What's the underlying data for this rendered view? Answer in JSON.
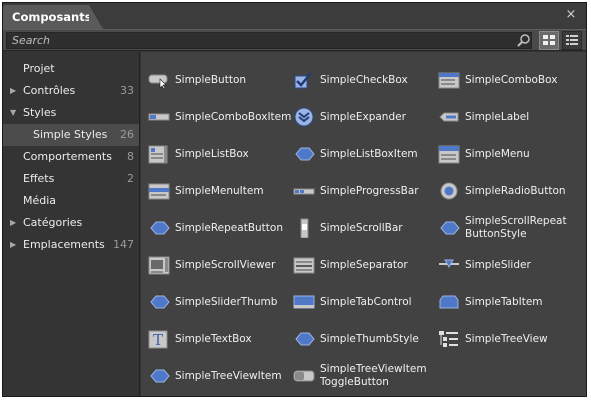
{
  "panel": {
    "tab_label": "Composants",
    "close_glyph": "×"
  },
  "search": {
    "placeholder": "Search"
  },
  "sidebar": {
    "items": [
      {
        "label": "Projet",
        "count": "",
        "arrow": ""
      },
      {
        "label": "Contrôles",
        "count": "33",
        "arrow": "▶"
      },
      {
        "label": "Styles",
        "count": "",
        "arrow": "▼"
      },
      {
        "label": "Simple Styles",
        "count": "26",
        "arrow": ""
      },
      {
        "label": "Comportements",
        "count": "8",
        "arrow": ""
      },
      {
        "label": "Effets",
        "count": "2",
        "arrow": ""
      },
      {
        "label": "Média",
        "count": "",
        "arrow": ""
      },
      {
        "label": "Catégories",
        "count": "",
        "arrow": "▶"
      },
      {
        "label": "Emplacements",
        "count": "147",
        "arrow": "▶"
      }
    ]
  },
  "components": [
    {
      "label": "SimpleButton",
      "icon": "button-icon"
    },
    {
      "label": "SimpleCheckBox",
      "icon": "checkbox-icon"
    },
    {
      "label": "SimpleComboBox",
      "icon": "combobox-icon"
    },
    {
      "label": "SimpleComboBoxItem",
      "icon": "comboboxitem-icon"
    },
    {
      "label": "SimpleExpander",
      "icon": "expander-icon"
    },
    {
      "label": "SimpleLabel",
      "icon": "label-icon"
    },
    {
      "label": "SimpleListBox",
      "icon": "listbox-icon"
    },
    {
      "label": "SimpleListBoxItem",
      "icon": "listboxitem-icon"
    },
    {
      "label": "SimpleMenu",
      "icon": "menu-icon"
    },
    {
      "label": "SimpleMenuItem",
      "icon": "menuitem-icon"
    },
    {
      "label": "SimpleProgressBar",
      "icon": "progressbar-icon"
    },
    {
      "label": "SimpleRadioButton",
      "icon": "radiobutton-icon"
    },
    {
      "label": "SimpleRepeatButton",
      "icon": "repeatbutton-icon"
    },
    {
      "label": "SimpleScrollBar",
      "icon": "scrollbar-icon"
    },
    {
      "label": "SimpleScrollRepeat ButtonStyle",
      "icon": "scrollrepeatbutton-icon"
    },
    {
      "label": "SimpleScrollViewer",
      "icon": "scrollviewer-icon"
    },
    {
      "label": "SimpleSeparator",
      "icon": "separator-icon"
    },
    {
      "label": "SimpleSlider",
      "icon": "slider-icon"
    },
    {
      "label": "SimpleSliderThumb",
      "icon": "sliderthumb-icon"
    },
    {
      "label": "SimpleTabControl",
      "icon": "tabcontrol-icon"
    },
    {
      "label": "SimpleTabItem",
      "icon": "tabitem-icon"
    },
    {
      "label": "SimpleTextBox",
      "icon": "textbox-icon"
    },
    {
      "label": "SimpleThumbStyle",
      "icon": "thumbstyle-icon"
    },
    {
      "label": "SimpleTreeView",
      "icon": "treeview-icon"
    },
    {
      "label": "SimpleTreeViewItem",
      "icon": "treeviewitem-icon"
    },
    {
      "label": "SimpleTreeViewItem ToggleButton",
      "icon": "treeviewitemtogglebutton-icon"
    }
  ],
  "colors": {
    "panel_bg": "#343434",
    "content_bg": "#424242",
    "selected_bg": "#4c4c4c",
    "accent": "#4a6fb5"
  }
}
